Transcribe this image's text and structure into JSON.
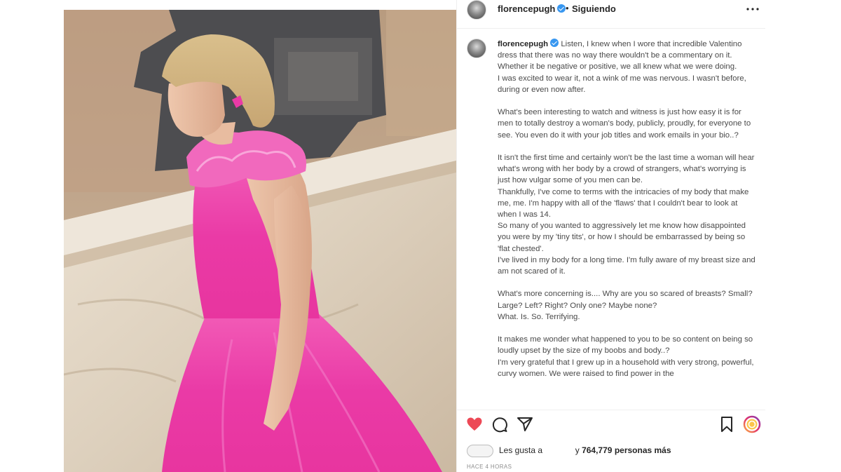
{
  "post": {
    "username": "florencepugh",
    "dot": "•",
    "follow_status": "Siguiendo"
  },
  "caption": {
    "username": "florencepugh",
    "paragraphs": [
      [
        "Listen, I knew when I wore that incredible Valentino dress that there was no way there wouldn't be a commentary on it. Whether it be negative or positive, we all knew what we were doing.",
        "I was excited to wear it, not a wink of me was nervous. I wasn't before, during or even now after."
      ],
      [
        "What's been interesting to watch and witness is just how easy it is for men to totally destroy a woman's body, publicly, proudly, for everyone to see. You even do it with your job titles and work emails in your bio..?"
      ],
      [
        "It isn't the first time and certainly won't be the last time a woman will hear what's wrong with her body by a crowd of strangers, what's worrying is just how vulgar some of you men can be.",
        "Thankfully, I've come to terms with the intricacies of my body that make me, me. I'm happy with all of the 'flaws' that I couldn't bear to look at when I was 14.",
        "So many of you wanted to aggressively let me know how disappointed you were by my 'tiny tits', or how I should be embarrassed by being so 'flat chested'.",
        "I've lived in my body for a long time. I'm fully aware of my breast size and am not scared of it."
      ],
      [
        "What's more concerning is.... Why are you so scared of breasts? Small? Large? Left? Right? Only one? Maybe none?",
        "What. Is. So. Terrifying."
      ],
      [
        "It makes me wonder what happened to you to be so content on being so loudly upset by the size of my boobs and body..?",
        "I'm very grateful that I grew up in a household with very strong, powerful, curvy women. We were raised to find power in the"
      ]
    ]
  },
  "likes": {
    "prefix": "Les gusta a",
    "middle": "y",
    "count": "764,779",
    "suffix": "personas más"
  },
  "timestamp": "HACE 4 HORAS",
  "colors": {
    "like_red": "#ed4956",
    "dress_pink": "#ea3aa6",
    "verified_blue": "#3897f0"
  },
  "icons": [
    "heart-icon",
    "comment-icon",
    "share-icon",
    "bookmark-icon",
    "more-icon",
    "chevron-right-icon"
  ]
}
